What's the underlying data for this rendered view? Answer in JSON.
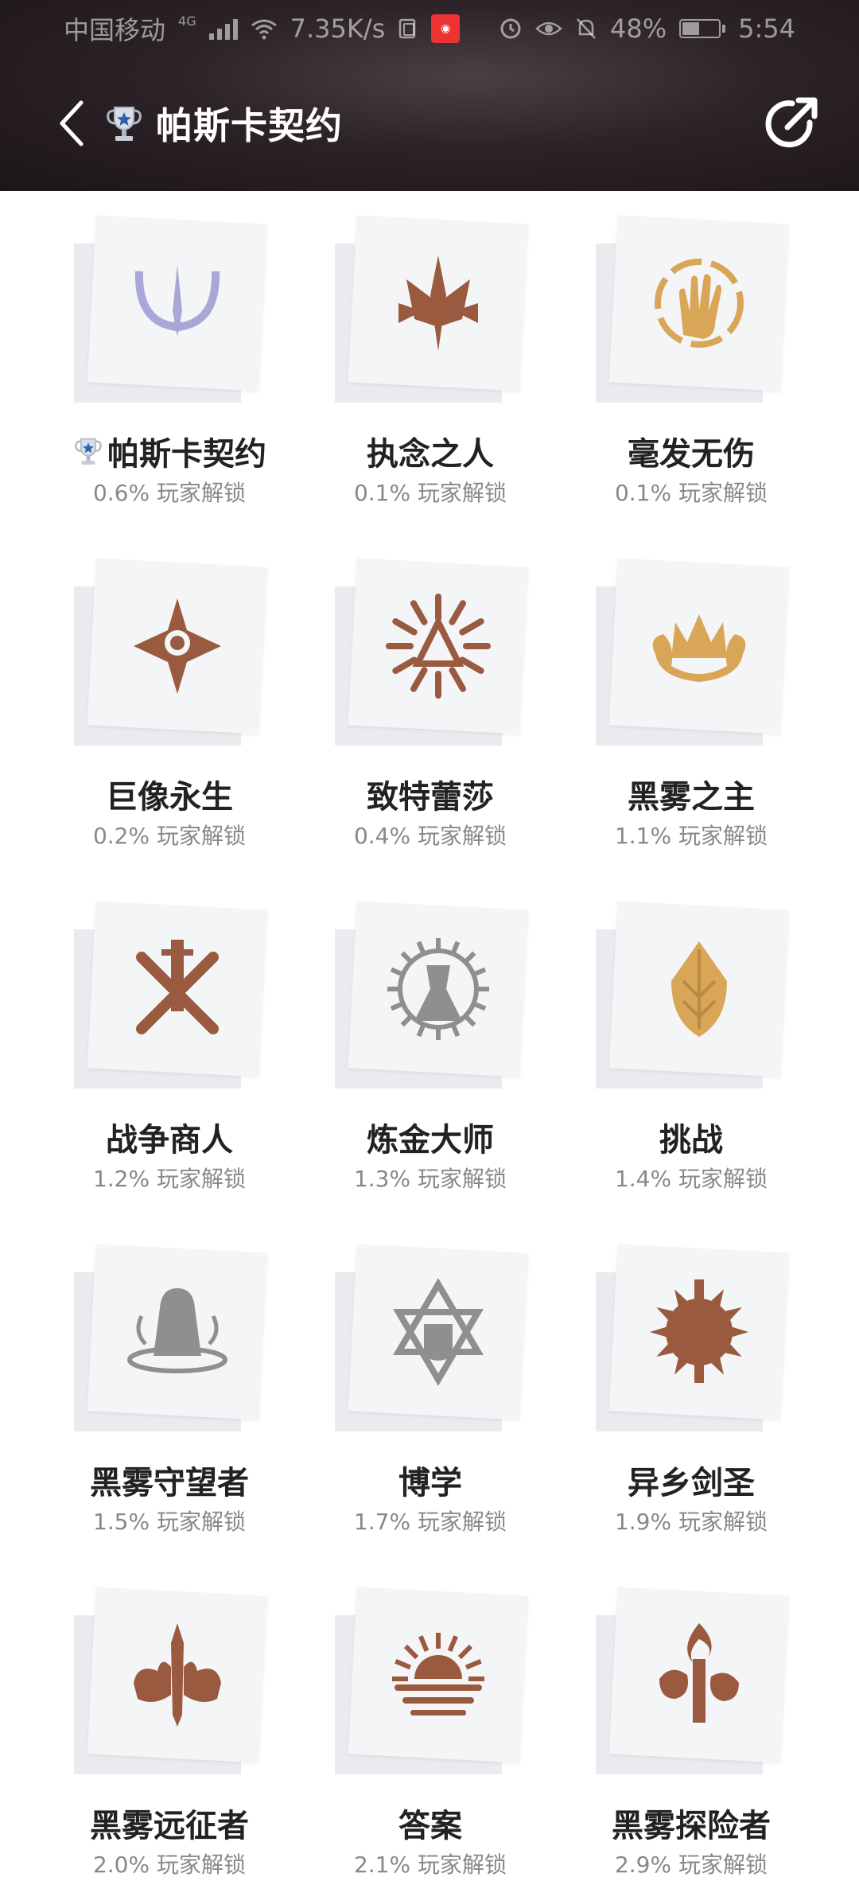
{
  "status_bar": {
    "carrier": "中国移动",
    "network": "4G",
    "speed": "7.35K/s",
    "battery": "48%",
    "time": "5:54"
  },
  "header": {
    "title": "帕斯卡契约"
  },
  "achievements": [
    {
      "name": "帕斯卡契约",
      "unlock": "0.6% 玩家解锁",
      "color": "#a9a6d8",
      "icon": "crescent-sword-emblem-icon",
      "trophy": true
    },
    {
      "name": "执念之人",
      "unlock": "0.1% 玩家解锁",
      "color": "#9a5a3f",
      "icon": "spiked-crest-emblem-icon"
    },
    {
      "name": "毫发无伤",
      "unlock": "0.1% 玩家解锁",
      "color": "#d9a657",
      "icon": "hand-emblem-icon"
    },
    {
      "name": "巨像永生",
      "unlock": "0.2% 玩家解锁",
      "color": "#9a5a3f",
      "icon": "eye-star-emblem-icon"
    },
    {
      "name": "致特蕾莎",
      "unlock": "0.4% 玩家解锁",
      "color": "#9a5a3f",
      "icon": "sunburst-triangle-emblem-icon"
    },
    {
      "name": "黑雾之主",
      "unlock": "1.1% 玩家解锁",
      "color": "#d9a657",
      "icon": "crown-emblem-icon"
    },
    {
      "name": "战争商人",
      "unlock": "1.2% 玩家解锁",
      "color": "#9a5a3f",
      "icon": "crossed-swords-emblem-icon"
    },
    {
      "name": "炼金大师",
      "unlock": "1.3% 玩家解锁",
      "color": "#8f8f8f",
      "icon": "gear-flask-emblem-icon"
    },
    {
      "name": "挑战",
      "unlock": "1.4% 玩家解锁",
      "color": "#d9a657",
      "icon": "shield-leaf-emblem-icon"
    },
    {
      "name": "黑雾守望者",
      "unlock": "1.5% 玩家解锁",
      "color": "#8f8f8f",
      "icon": "hooded-figure-emblem-icon"
    },
    {
      "name": "博学",
      "unlock": "1.7% 玩家解锁",
      "color": "#8f8f8f",
      "icon": "hexagram-emblem-icon"
    },
    {
      "name": "异乡剑圣",
      "unlock": "1.9% 玩家解锁",
      "color": "#9a5a3f",
      "icon": "sword-sun-emblem-icon"
    },
    {
      "name": "黑雾远征者",
      "unlock": "2.0% 玩家解锁",
      "color": "#9a5a3f",
      "icon": "sword-cloud-emblem-icon"
    },
    {
      "name": "答案",
      "unlock": "2.1% 玩家解锁",
      "color": "#9a5a3f",
      "icon": "rising-sun-emblem-icon"
    },
    {
      "name": "黑雾探险者",
      "unlock": "2.9% 玩家解锁",
      "color": "#9a5a3f",
      "icon": "torch-emblem-icon"
    }
  ]
}
